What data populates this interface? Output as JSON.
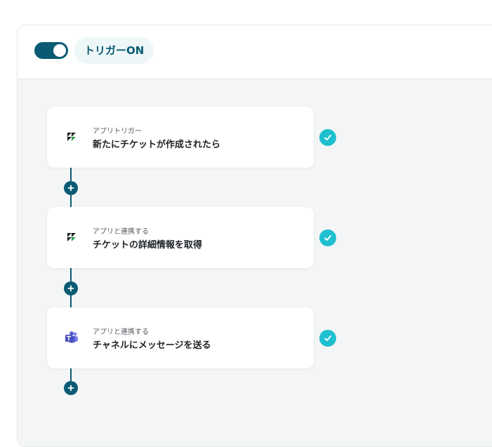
{
  "header": {
    "toggle_state": "on",
    "trigger_label": "トリガーON"
  },
  "colors": {
    "primary": "#0a5a73",
    "check": "#1ec0d0",
    "badge_bg": "#eef7f8",
    "canvas_bg": "#f4f5f6",
    "teams": "#5059c9"
  },
  "steps": [
    {
      "subtitle": "アプリトリガー",
      "title": "新たにチケットが作成されたら",
      "icon": "zendesk-icon",
      "status": "complete"
    },
    {
      "subtitle": "アプリと連携する",
      "title": "チケットの詳細情報を取得",
      "icon": "zendesk-icon",
      "status": "complete"
    },
    {
      "subtitle": "アプリと連携する",
      "title": "チャネルにメッセージを送る",
      "icon": "microsoft-teams-icon",
      "status": "complete"
    }
  ]
}
